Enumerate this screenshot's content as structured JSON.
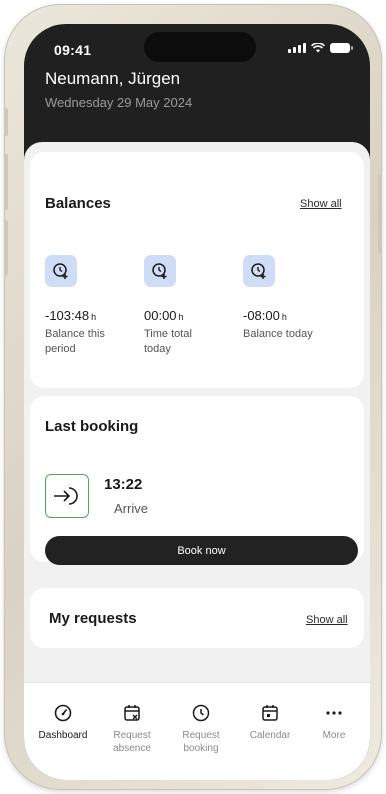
{
  "status_bar": {
    "time": "09:41"
  },
  "header": {
    "name": "Neumann, Jürgen",
    "date": "Wednesday 29 May 2024"
  },
  "balances": {
    "title": "Balances",
    "show_all": "Show all",
    "items": [
      {
        "value": "-103:48",
        "unit": "h",
        "label_line1": "Balance this",
        "label_line2": "period",
        "icon": "clock-plus-icon"
      },
      {
        "value": "00:00",
        "unit": "h",
        "label_line1": "Time total",
        "label_line2": "today",
        "icon": "clock-plus-icon"
      },
      {
        "value": "-08:00",
        "unit": "h",
        "label_line1": "Balance today",
        "label_line2": "",
        "icon": "clock-plus-icon"
      }
    ]
  },
  "last_booking": {
    "title": "Last booking",
    "time": "13:22",
    "type": "Arrive",
    "button": "Book now",
    "icon": "arrive-icon"
  },
  "requests": {
    "title": "My requests",
    "show_all": "Show all"
  },
  "tabs": [
    {
      "line1": "Dashboard",
      "line2": "",
      "icon": "dashboard-icon"
    },
    {
      "line1": "Request",
      "line2": "absence",
      "icon": "calendar-x-icon"
    },
    {
      "line1": "Request",
      "line2": "booking",
      "icon": "clock-icon"
    },
    {
      "line1": "Calendar",
      "line2": "",
      "icon": "calendar-icon"
    },
    {
      "line1": "More",
      "line2": "",
      "icon": "more-icon"
    }
  ],
  "colors": {
    "accent_icon_bg": "#cfdcf6",
    "arrive_border": "#4caf50",
    "header_bg": "#202020"
  }
}
